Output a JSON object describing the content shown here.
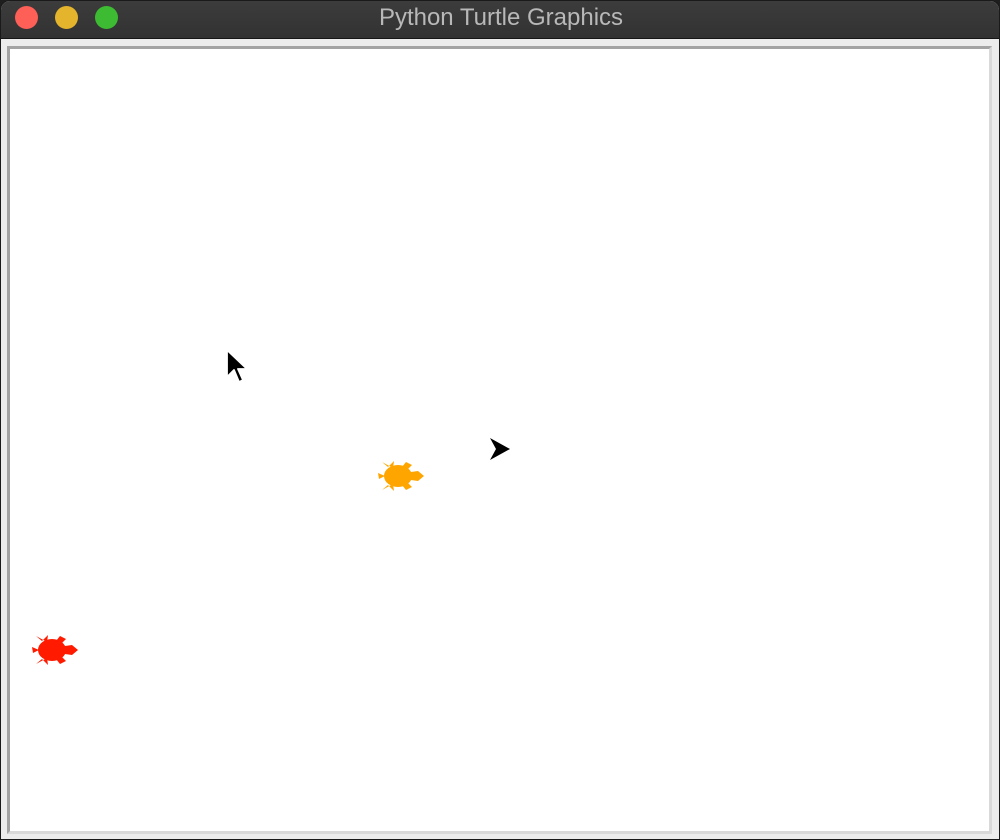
{
  "window": {
    "title": "Python Turtle Graphics",
    "controls": [
      {
        "name": "close",
        "color": "#fe5f57"
      },
      {
        "name": "minimize",
        "color": "#e5b42d"
      },
      {
        "name": "maximize",
        "color": "#3dbb33"
      }
    ]
  },
  "canvas": {
    "background": "#ffffff",
    "sprites": [
      {
        "name": "orange-turtle",
        "shape": "turtle",
        "color": "#ffa500",
        "heading": "east"
      },
      {
        "name": "red-turtle",
        "shape": "turtle",
        "color": "#ff1a00",
        "heading": "east"
      },
      {
        "name": "default-arrow",
        "shape": "arrow",
        "color": "#000000",
        "heading": "east"
      }
    ]
  },
  "mouse_pointer": {
    "icon": "mouse-pointer-icon"
  }
}
